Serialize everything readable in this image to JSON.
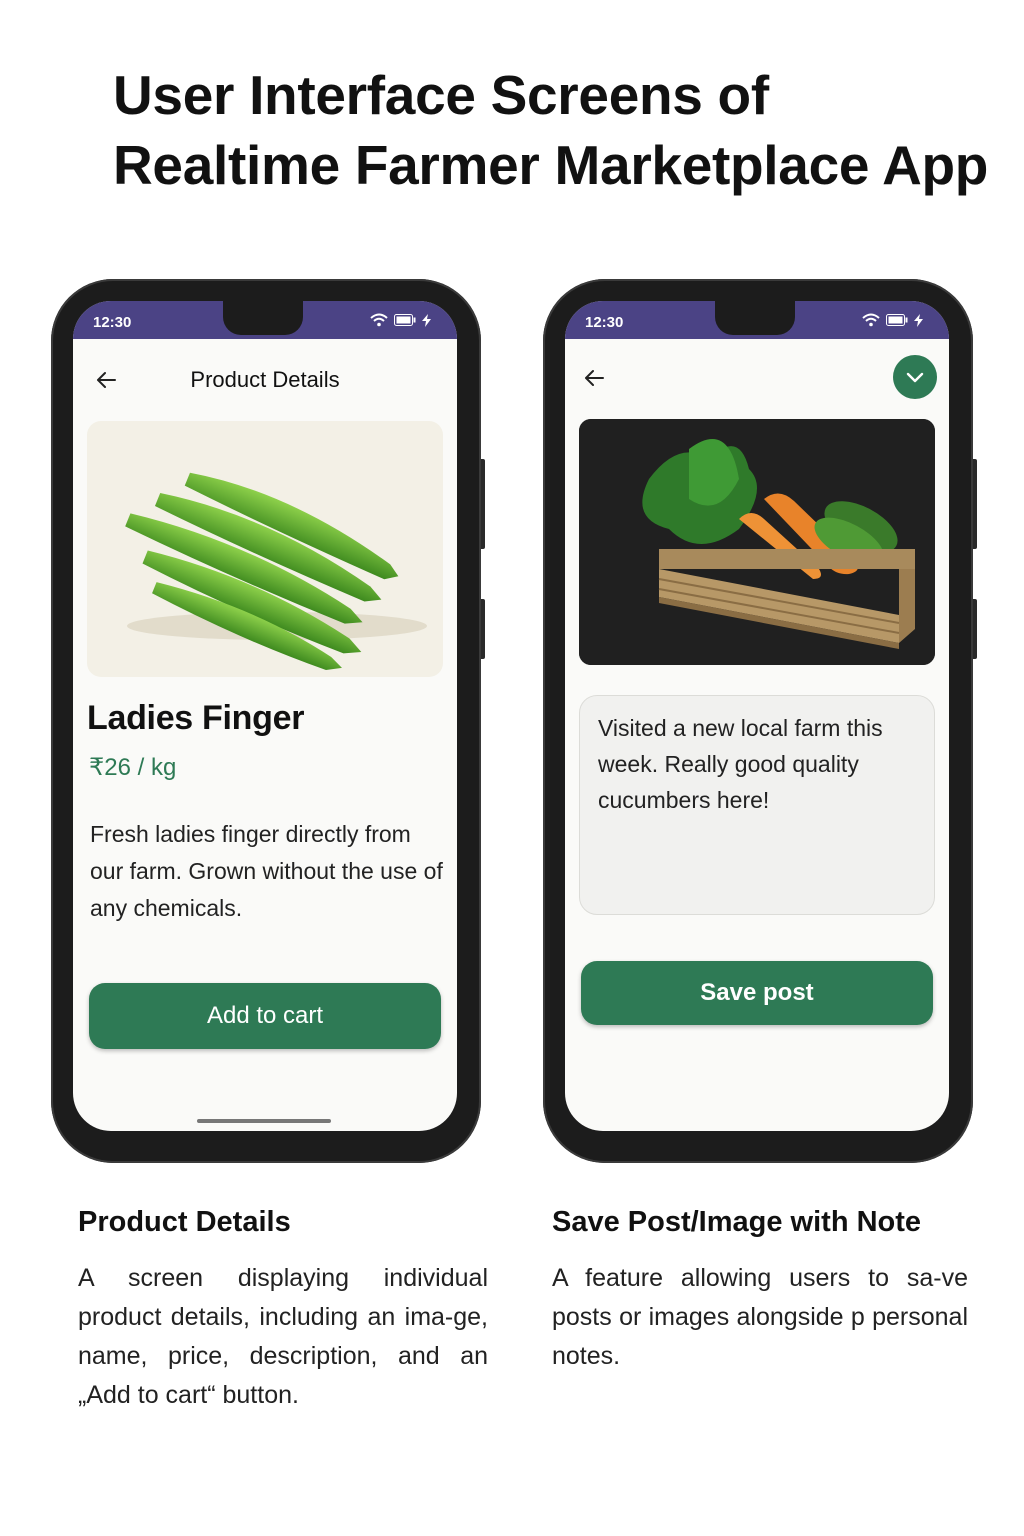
{
  "page_title": {
    "line1": "User Interface Screens of",
    "line2": "Realtime Farmer Marketplace App"
  },
  "status_bar": {
    "time": "12:30",
    "bg_color": "#4b4385",
    "icons": [
      "wifi-icon",
      "battery-icon",
      "charging-bolt-icon"
    ]
  },
  "colors": {
    "accent_green": "#2e7a55",
    "status_purple": "#4b4385"
  },
  "product_screen": {
    "header_title": "Product Details",
    "back_icon": "arrow-left-icon",
    "image_alt": "okra-image",
    "name": "Ladies Finger",
    "price": "₹26 / kg",
    "description": "Fresh ladies finger directly from our farm. Grown without the use of any chemicals.",
    "add_to_cart_label": "Add to cart"
  },
  "post_screen": {
    "back_icon": "arrow-left-icon",
    "confirm_icon": "check-icon",
    "image_alt": "vegetable-crate-image",
    "note_text": "Visited a new local farm this week. Really good quality cucumbers here!",
    "save_label": "Save post"
  },
  "captions": {
    "left": {
      "title": "Product Details",
      "text": "A screen displaying individual product details, including an ima-ge, name, price, description, and an „Add to cart“ button."
    },
    "right": {
      "title": "Save Post/Image with Note",
      "text": "A feature allowing users to sa-ve posts or images alongside p personal notes."
    }
  }
}
